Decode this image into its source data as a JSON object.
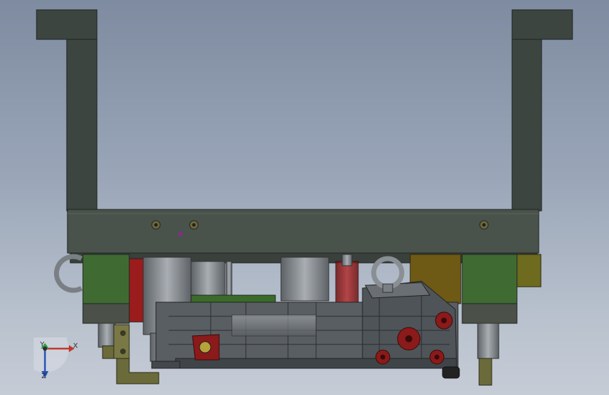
{
  "viewport": {
    "background_top": "#7e8ba0",
    "background_bottom": "#c6ccd6"
  },
  "model": {
    "description_icon": "cad-assembly",
    "colors": {
      "frame": "#3d4540",
      "frame_edge": "#1e2420",
      "plate": "#4a524c",
      "green_block": "#3f6b33",
      "red_part": "#8b1a1a",
      "metal": "#8a8f94",
      "olive": "#6b6a3a",
      "yellow_block": "#6e6a1e"
    }
  },
  "triad": {
    "x_label": "X",
    "y_label": "Y",
    "z_label": "Z",
    "x_color": "#c0392b",
    "y_color": "#2ea043",
    "z_color": "#2451b5"
  }
}
